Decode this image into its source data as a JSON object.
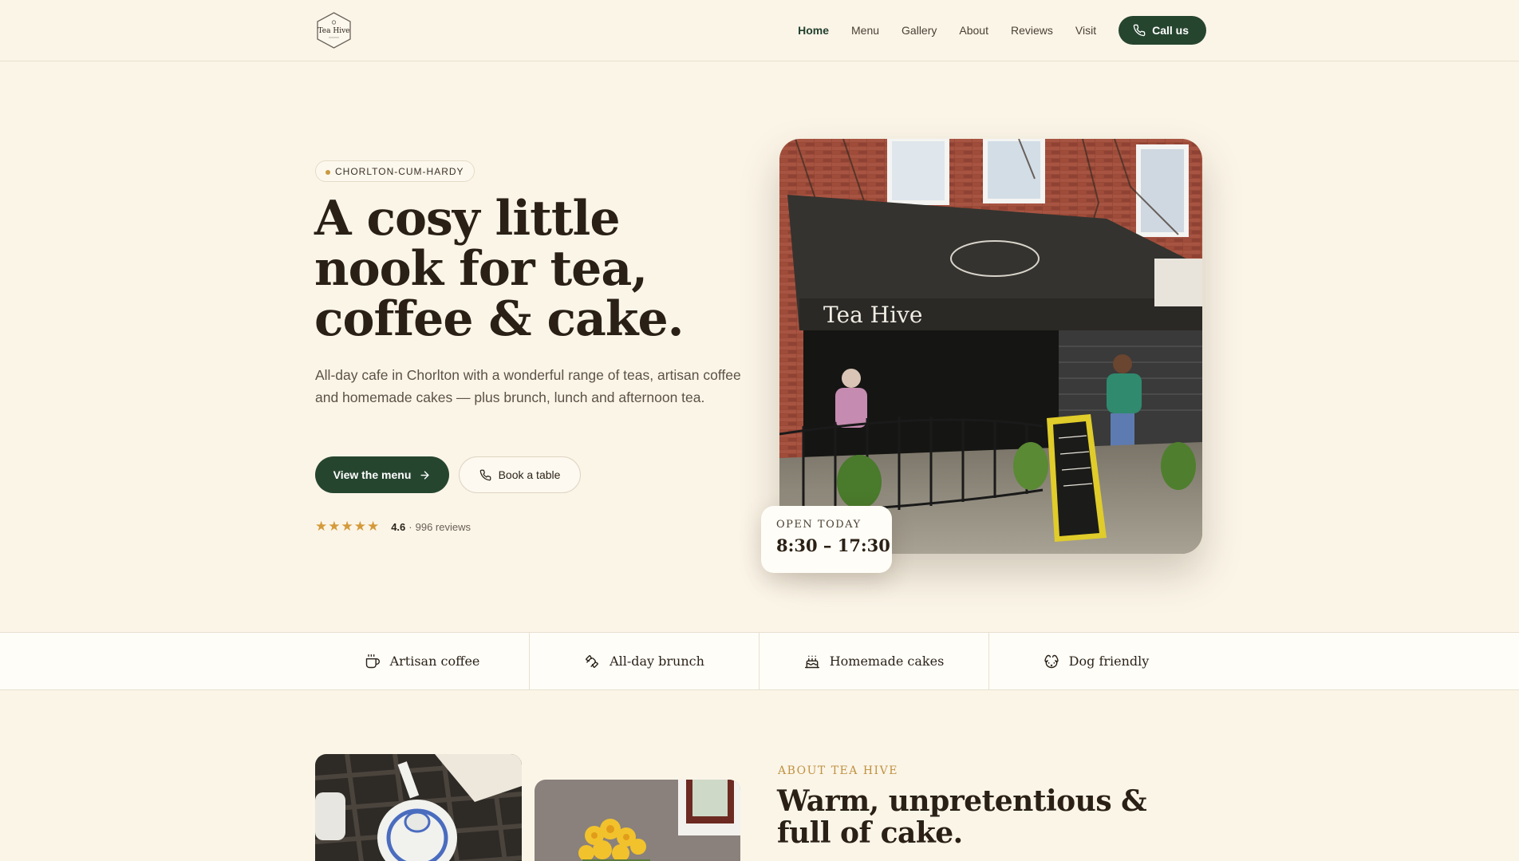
{
  "nav": {
    "logo_text": "Tea Hive",
    "links": [
      "Home",
      "Menu",
      "Gallery",
      "About",
      "Reviews",
      "Visit"
    ],
    "active": "Home",
    "call_label": "Call us"
  },
  "hero": {
    "location_pill": "CHORLTON-CUM-HARDY",
    "title": "A cosy little nook for tea, coffee & cake.",
    "subtitle": "All-day cafe in Chorlton with a wonderful range of teas, artisan coffee and homemade cakes — plus brunch, lunch and afternoon tea.",
    "primary_button": "View the menu",
    "secondary_button": "Book a table",
    "rating_stars": 5,
    "rating_value": "4.6",
    "rating_separator": "·",
    "review_count": "996 reviews",
    "open_label": "OPEN TODAY",
    "open_hours": "8:30 – 17:30",
    "storefront_sign": "Tea Hive"
  },
  "features": [
    {
      "label": "Artisan coffee",
      "icon": "coffee-cup-icon"
    },
    {
      "label": "All-day brunch",
      "icon": "croissant-icon"
    },
    {
      "label": "Homemade cakes",
      "icon": "cake-icon"
    },
    {
      "label": "Dog friendly",
      "icon": "dog-icon"
    }
  ],
  "about": {
    "kicker": "ABOUT TEA HIVE",
    "title": "Warm, unpretentious & full of cake."
  },
  "colors": {
    "background": "#fbf5e8",
    "primary_green": "#26452f",
    "accent_gold": "#c0923f",
    "star": "#d49a3a",
    "heading": "#2a2015"
  }
}
